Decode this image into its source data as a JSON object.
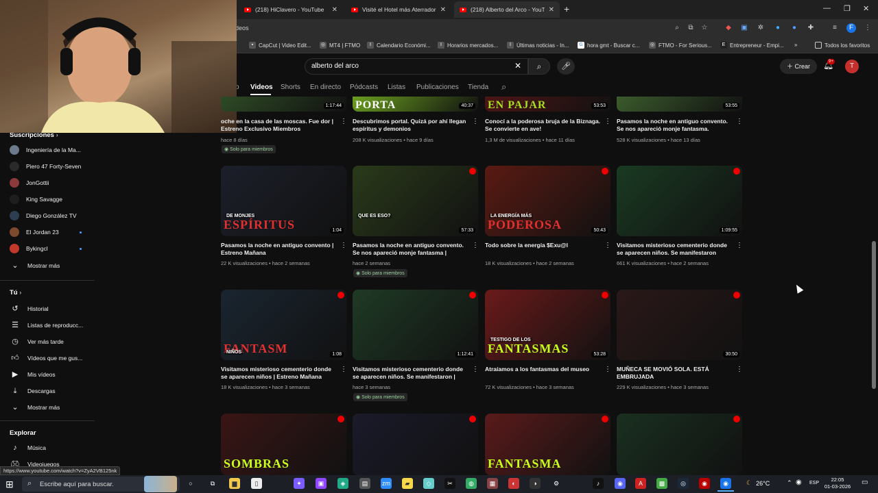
{
  "browser": {
    "tabs": [
      {
        "title": "(218) HiClavero - YouTube",
        "active": false
      },
      {
        "title": "Visité el Hotel más Aterrador de",
        "active": false
      },
      {
        "title": "(218) Alberto del Arco - YouTub",
        "active": true
      }
    ],
    "url_fragment": "deos",
    "bookmarks": [
      "CapCut | Video Edit...",
      "MT4 | FTMO",
      "Calendario Económi...",
      "Horarios mercados...",
      "Últimas noticias - In...",
      "hora gmt - Buscar c...",
      "FTMO - For Serious...",
      "Entrepreneur - Empi..."
    ],
    "bookmarks_folder": "Todos los favoritos",
    "profile_initial": "F"
  },
  "header": {
    "search_value": "alberto del arco",
    "create_label": "Crear",
    "notifications_badge": "9+",
    "avatar_initial": "T"
  },
  "channel_tabs": [
    {
      "label": "o",
      "active": false
    },
    {
      "label": "Videos",
      "active": true
    },
    {
      "label": "Shorts",
      "active": false
    },
    {
      "label": "En directo",
      "active": false
    },
    {
      "label": "Pódcasts",
      "active": false
    },
    {
      "label": "Listas",
      "active": false
    },
    {
      "label": "Publicaciones",
      "active": false
    },
    {
      "label": "Tienda",
      "active": false
    }
  ],
  "sidebar": {
    "subscriptions_title": "Suscripciones",
    "subscriptions": [
      {
        "name": "Ingeniería de la Ma...",
        "color": "#6b7b8c",
        "live": false
      },
      {
        "name": "Piero 47 Forty-Seven",
        "color": "#2a2a2a",
        "live": false
      },
      {
        "name": "JonGottii",
        "color": "#8a3a3a",
        "live": false
      },
      {
        "name": "King Savagge",
        "color": "#1e1e1e",
        "live": false
      },
      {
        "name": "Diego González TV",
        "color": "#2c3e50",
        "live": false
      },
      {
        "name": "El Jordan 23",
        "color": "#7d4a2e",
        "live": true
      },
      {
        "name": "Bykingcl",
        "color": "#c0392b",
        "live": true
      }
    ],
    "subscriptions_more": "Mostrar más",
    "you_title": "Tú",
    "you_items": [
      {
        "label": "Historial",
        "icon": "history-icon"
      },
      {
        "label": "Listas de reproducc...",
        "icon": "playlist-icon"
      },
      {
        "label": "Ver más tarde",
        "icon": "clock-icon"
      },
      {
        "label": "Vídeos que me gus...",
        "icon": "thumbs-up-icon"
      },
      {
        "label": "Mis vídeos",
        "icon": "my-videos-icon"
      },
      {
        "label": "Descargas",
        "icon": "download-icon"
      },
      {
        "label": "Mostrar más",
        "icon": "chevron-down-icon"
      }
    ],
    "explore_title": "Explorar",
    "explore_items": [
      {
        "label": "Música",
        "icon": "music-icon"
      },
      {
        "label": "Videojuegos",
        "icon": "gamepad-icon"
      }
    ]
  },
  "videos_row0": [
    {
      "title": "Noche en la casa de las moscas. Fue ador | Estreno Exclusivo Miembros",
      "title_display": "oche en la casa de las moscas. Fue dor | Estreno Exclusivo Miembros",
      "meta": "hace 8 días",
      "duration": "1:17:44",
      "badge": "Solo para miembros",
      "overlay": ""
    },
    {
      "title": "Descubrimos portal. Quizá por ahí llegan espíritus y demonios",
      "title_display": "Descubrimos portal. Quizá por ahí llegan espíritus y demonios",
      "meta": "208 K visualizaciones • hace 9 días",
      "duration": "40:37",
      "badge": "",
      "overlay": "PORTA"
    },
    {
      "title": "Conocí a la poderosa bruja de la Biznaga. Se convierte en ave!",
      "title_display": "Conocí a la poderosa bruja de la Biznaga. Se convierte en ave!",
      "meta": "1,3 M de visualizaciones • hace 11 días",
      "duration": "53:53",
      "badge": "",
      "overlay": "EN PAJAR"
    },
    {
      "title": "Pasamos la noche en antiguo convento. Se nos apareció monje fantasma.",
      "title_display": "Pasamos la noche en antiguo convento. Se nos apareció monje fantasma.",
      "meta": "528 K visualizaciones • hace 13 días",
      "duration": "53:55",
      "badge": "",
      "overlay": ""
    }
  ],
  "videos_row1": [
    {
      "title": "Pasamos la noche en antiguo convento | Estreno Mañana",
      "meta": "22 K visualizaciones • hace 2 semanas",
      "duration": "1:04",
      "badge": "",
      "overlay": "ESPÍRITUS",
      "overlay_small": "DE MONJES"
    },
    {
      "title": "Pasamos la noche en antiguo convento. Se nos apareció monje fantasma | Estreno...",
      "meta": "hace 2 semanas",
      "duration": "57:33",
      "badge": "Solo para miembros",
      "overlay": "",
      "overlay_small": "QUE ES ESO?"
    },
    {
      "title": "Todo sobre la energía $Exu@l",
      "meta": "18 K visualizaciones • hace 2 semanas",
      "duration": "50:43",
      "badge": "",
      "overlay": "PODEROSA",
      "overlay_small": "LA ENERGÍA MÁS"
    },
    {
      "title": "Visitamos misterioso cementerio donde se aparecen niños. Se manifestaron ante...",
      "meta": "661 K visualizaciones • hace 2 semanas",
      "duration": "1:09:55",
      "badge": "",
      "overlay": "",
      "overlay_small": ""
    }
  ],
  "videos_row2": [
    {
      "title": "Visitamos misterioso cementerio donde se aparecen niños | Estreno Mañana",
      "meta": "18 K visualizaciones • hace 3 semanas",
      "duration": "1:08",
      "badge": "",
      "overlay": "FANTASM",
      "overlay_small": "NIÑOS"
    },
    {
      "title": "Visitamos misterioso cementerio donde se aparecen niños. Se manifestaron | Estreno...",
      "meta": "hace 3 semanas",
      "duration": "1:12:41",
      "badge": "Solo para miembros",
      "overlay": "",
      "overlay_small": ""
    },
    {
      "title": "Atraíamos a los fantasmas del museo",
      "meta": "72 K visualizaciones • hace 3 semanas",
      "duration": "53:28",
      "badge": "",
      "overlay": "FANTASMAS",
      "overlay_small": "TESTIGO DE LOS"
    },
    {
      "title": "MUÑECA SE MOVIÓ SOLA. ESTÁ EMBRUJADA",
      "meta": "229 K visualizaciones • hace 3 semanas",
      "duration": "30:50",
      "badge": "",
      "overlay": "",
      "overlay_small": ""
    }
  ],
  "videos_row3": [
    {
      "overlay": "SOMBRAS"
    },
    {
      "overlay": ""
    },
    {
      "overlay": "FANTASMA"
    },
    {
      "overlay": ""
    }
  ],
  "status_url": "https://www.youtube.com/watch?v=ZyA2VB125nk",
  "taskbar": {
    "search_placeholder": "Escribe aquí para buscar.",
    "temperature": "26°C",
    "language": "ESP",
    "time": "22:05",
    "date": "01-03-2026"
  }
}
